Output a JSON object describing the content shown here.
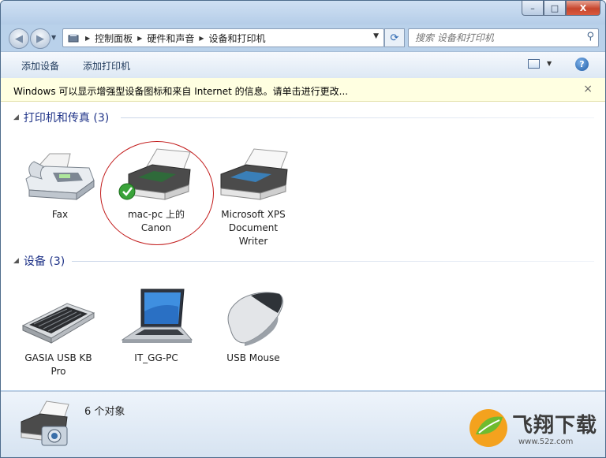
{
  "window": {
    "title": "设备和打印机",
    "buttons": {
      "minimize": "–",
      "maximize": "□",
      "close": "X"
    }
  },
  "nav": {
    "back_icon": "back-arrow-icon",
    "forward_icon": "forward-arrow-icon",
    "breadcrumbs": [
      "控制面板",
      "硬件和声音",
      "设备和打印机"
    ],
    "search_placeholder": "搜索 设备和打印机"
  },
  "toolbar": {
    "add_device": "添加设备",
    "add_printer": "添加打印机"
  },
  "infobar": {
    "text": "Windows 可以显示增强型设备图标和来自 Internet 的信息。请单击进行更改...",
    "close": "×"
  },
  "groups": [
    {
      "title": "打印机和传真 (3)",
      "items": [
        {
          "label": "Fax"
        },
        {
          "label": "mac-pc 上的 Canon"
        },
        {
          "label": "Microsoft XPS Document Writer"
        }
      ]
    },
    {
      "title": "设备 (3)",
      "items": [
        {
          "label": "GASIA USB KB Pro"
        },
        {
          "label": "IT_GG-PC"
        },
        {
          "label": "USB Mouse"
        }
      ]
    }
  ],
  "details": {
    "count": "6 个对象"
  },
  "watermark": {
    "text": "飞翔下载",
    "url": "www.52z.com"
  },
  "colors": {
    "accent": "#1e3287",
    "annotation": "#c21b1b",
    "infobar": "#ffffe1"
  }
}
